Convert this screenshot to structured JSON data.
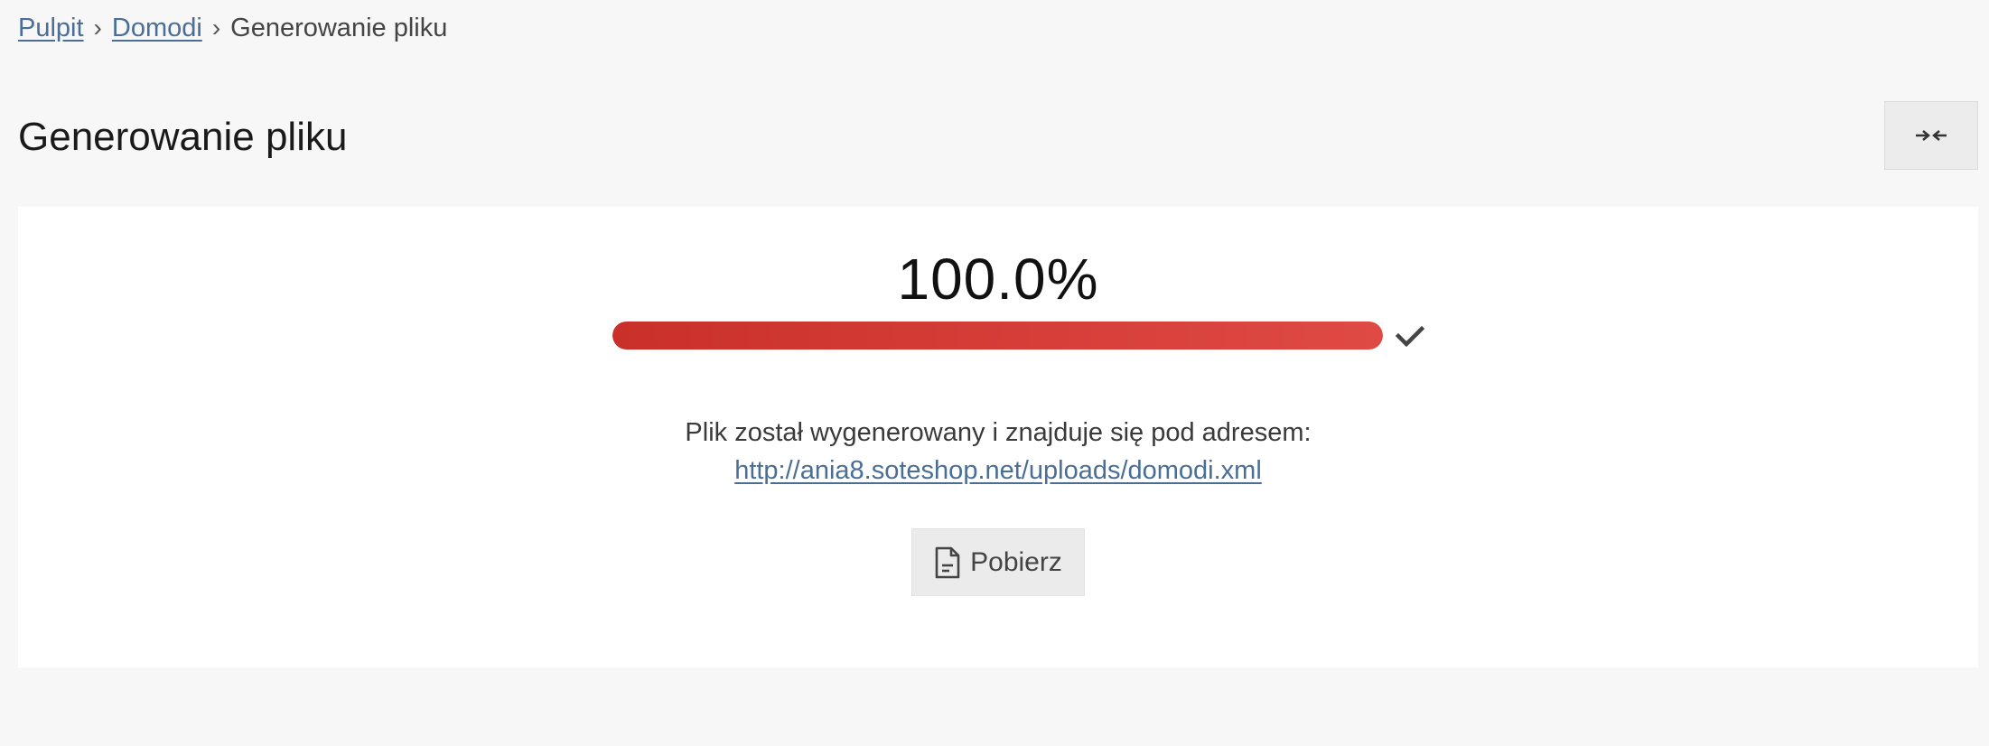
{
  "breadcrumb": {
    "items": [
      {
        "label": "Pulpit"
      },
      {
        "label": "Domodi"
      }
    ],
    "separator": "›",
    "current": "Generowanie pliku"
  },
  "page": {
    "title": "Generowanie pliku"
  },
  "toolbar": {
    "collapse_icon": "arrows-collapse-icon"
  },
  "progress": {
    "percent_label": "100.0%",
    "value": 1.0,
    "status_icon": "check-icon",
    "fill_colors": [
      "#c9302a",
      "#e04a44"
    ]
  },
  "result": {
    "message": "Plik został wygenerowany i znajduje się pod adresem:",
    "url": "http://ania8.soteshop.net/uploads/domodi.xml"
  },
  "download": {
    "label": "Pobierz",
    "icon": "document-icon"
  },
  "colors": {
    "background": "#f7f7f7",
    "link": "#4a6e96",
    "panel": "#ffffff"
  }
}
